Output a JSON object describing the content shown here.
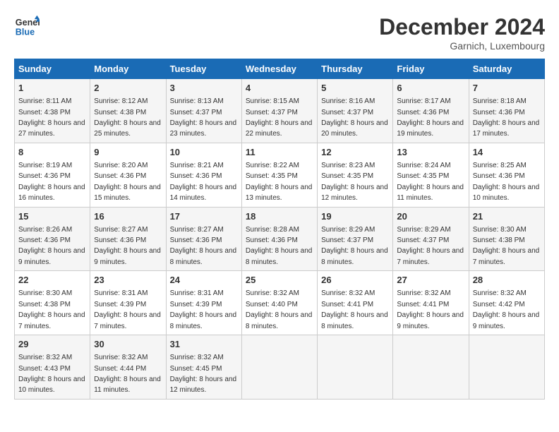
{
  "header": {
    "logo_line1": "General",
    "logo_line2": "Blue",
    "month": "December 2024",
    "location": "Garnich, Luxembourg"
  },
  "days_of_week": [
    "Sunday",
    "Monday",
    "Tuesday",
    "Wednesday",
    "Thursday",
    "Friday",
    "Saturday"
  ],
  "weeks": [
    [
      {
        "day": 1,
        "sunrise": "8:11 AM",
        "sunset": "4:38 PM",
        "daylight": "8 hours and 27 minutes."
      },
      {
        "day": 2,
        "sunrise": "8:12 AM",
        "sunset": "4:38 PM",
        "daylight": "8 hours and 25 minutes."
      },
      {
        "day": 3,
        "sunrise": "8:13 AM",
        "sunset": "4:37 PM",
        "daylight": "8 hours and 23 minutes."
      },
      {
        "day": 4,
        "sunrise": "8:15 AM",
        "sunset": "4:37 PM",
        "daylight": "8 hours and 22 minutes."
      },
      {
        "day": 5,
        "sunrise": "8:16 AM",
        "sunset": "4:37 PM",
        "daylight": "8 hours and 20 minutes."
      },
      {
        "day": 6,
        "sunrise": "8:17 AM",
        "sunset": "4:36 PM",
        "daylight": "8 hours and 19 minutes."
      },
      {
        "day": 7,
        "sunrise": "8:18 AM",
        "sunset": "4:36 PM",
        "daylight": "8 hours and 17 minutes."
      }
    ],
    [
      {
        "day": 8,
        "sunrise": "8:19 AM",
        "sunset": "4:36 PM",
        "daylight": "8 hours and 16 minutes."
      },
      {
        "day": 9,
        "sunrise": "8:20 AM",
        "sunset": "4:36 PM",
        "daylight": "8 hours and 15 minutes."
      },
      {
        "day": 10,
        "sunrise": "8:21 AM",
        "sunset": "4:36 PM",
        "daylight": "8 hours and 14 minutes."
      },
      {
        "day": 11,
        "sunrise": "8:22 AM",
        "sunset": "4:35 PM",
        "daylight": "8 hours and 13 minutes."
      },
      {
        "day": 12,
        "sunrise": "8:23 AM",
        "sunset": "4:35 PM",
        "daylight": "8 hours and 12 minutes."
      },
      {
        "day": 13,
        "sunrise": "8:24 AM",
        "sunset": "4:35 PM",
        "daylight": "8 hours and 11 minutes."
      },
      {
        "day": 14,
        "sunrise": "8:25 AM",
        "sunset": "4:36 PM",
        "daylight": "8 hours and 10 minutes."
      }
    ],
    [
      {
        "day": 15,
        "sunrise": "8:26 AM",
        "sunset": "4:36 PM",
        "daylight": "8 hours and 9 minutes."
      },
      {
        "day": 16,
        "sunrise": "8:27 AM",
        "sunset": "4:36 PM",
        "daylight": "8 hours and 9 minutes."
      },
      {
        "day": 17,
        "sunrise": "8:27 AM",
        "sunset": "4:36 PM",
        "daylight": "8 hours and 8 minutes."
      },
      {
        "day": 18,
        "sunrise": "8:28 AM",
        "sunset": "4:36 PM",
        "daylight": "8 hours and 8 minutes."
      },
      {
        "day": 19,
        "sunrise": "8:29 AM",
        "sunset": "4:37 PM",
        "daylight": "8 hours and 8 minutes."
      },
      {
        "day": 20,
        "sunrise": "8:29 AM",
        "sunset": "4:37 PM",
        "daylight": "8 hours and 7 minutes."
      },
      {
        "day": 21,
        "sunrise": "8:30 AM",
        "sunset": "4:38 PM",
        "daylight": "8 hours and 7 minutes."
      }
    ],
    [
      {
        "day": 22,
        "sunrise": "8:30 AM",
        "sunset": "4:38 PM",
        "daylight": "8 hours and 7 minutes."
      },
      {
        "day": 23,
        "sunrise": "8:31 AM",
        "sunset": "4:39 PM",
        "daylight": "8 hours and 7 minutes."
      },
      {
        "day": 24,
        "sunrise": "8:31 AM",
        "sunset": "4:39 PM",
        "daylight": "8 hours and 8 minutes."
      },
      {
        "day": 25,
        "sunrise": "8:32 AM",
        "sunset": "4:40 PM",
        "daylight": "8 hours and 8 minutes."
      },
      {
        "day": 26,
        "sunrise": "8:32 AM",
        "sunset": "4:41 PM",
        "daylight": "8 hours and 8 minutes."
      },
      {
        "day": 27,
        "sunrise": "8:32 AM",
        "sunset": "4:41 PM",
        "daylight": "8 hours and 9 minutes."
      },
      {
        "day": 28,
        "sunrise": "8:32 AM",
        "sunset": "4:42 PM",
        "daylight": "8 hours and 9 minutes."
      }
    ],
    [
      {
        "day": 29,
        "sunrise": "8:32 AM",
        "sunset": "4:43 PM",
        "daylight": "8 hours and 10 minutes."
      },
      {
        "day": 30,
        "sunrise": "8:32 AM",
        "sunset": "4:44 PM",
        "daylight": "8 hours and 11 minutes."
      },
      {
        "day": 31,
        "sunrise": "8:32 AM",
        "sunset": "4:45 PM",
        "daylight": "8 hours and 12 minutes."
      },
      null,
      null,
      null,
      null
    ]
  ]
}
